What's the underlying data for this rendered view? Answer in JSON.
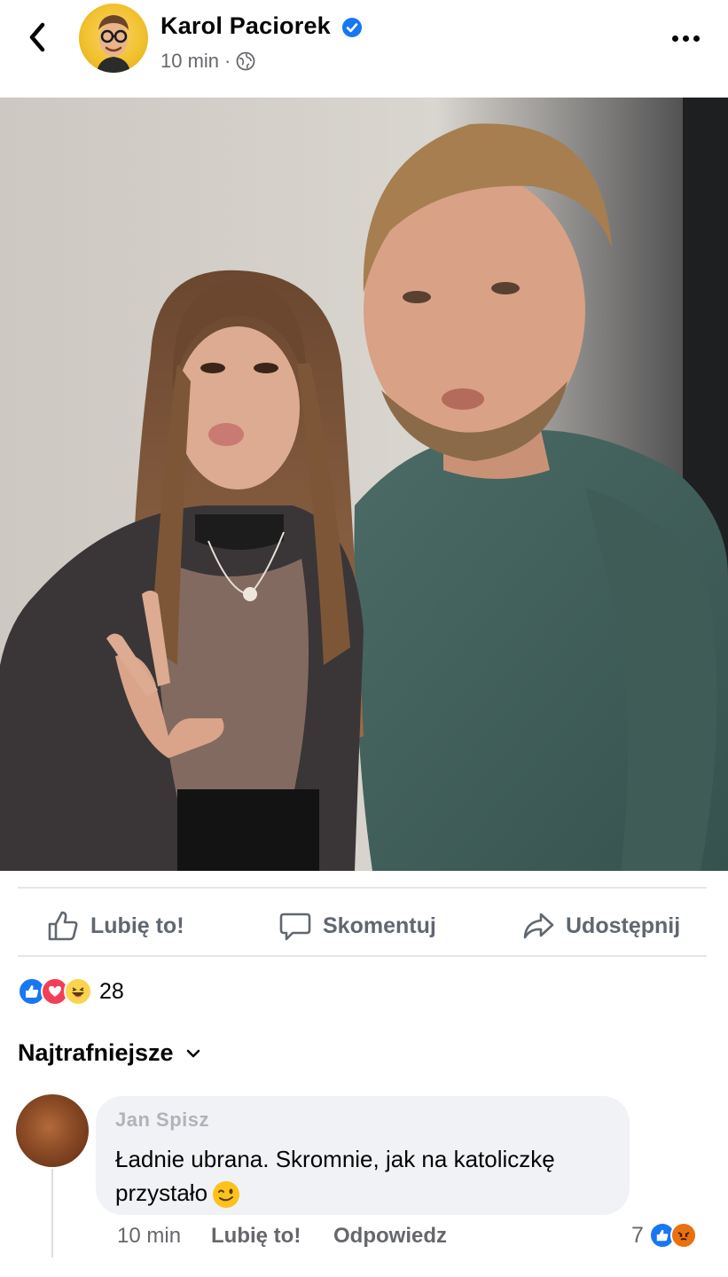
{
  "header": {
    "author": "Karol Paciorek",
    "verified": true,
    "time": "10 min",
    "separator": "·",
    "audience_icon": "globe-icon",
    "back_icon": "chevron-left-icon",
    "more_icon": "more-horizontal-icon"
  },
  "post": {
    "photo_alt": "selfie photo"
  },
  "actions": {
    "like": "Lubię to!",
    "comment": "Skomentuj",
    "share": "Udostępnij"
  },
  "reactions": {
    "types": [
      "like",
      "love",
      "haha"
    ],
    "count": "28"
  },
  "comments": {
    "sort_label": "Najtrafniejsze",
    "items": [
      {
        "author": "Jan Spisz",
        "text": "Ładnie ubrana. Skromnie, jak na katoliczkę przystało",
        "emoji": "winking-face",
        "time": "10 min",
        "like_label": "Lubię to!",
        "reply_label": "Odpowiedz",
        "reaction_count": "7",
        "reaction_types": [
          "like",
          "angry"
        ]
      }
    ]
  },
  "colors": {
    "facebook_blue": "#1877f2",
    "secondary_text": "#65676b",
    "bubble_bg": "#f0f2f5",
    "divider": "#e4e6eb",
    "love_red": "#f33e58",
    "haha_yellow": "#fcd34d",
    "angry_orange": "#e9710f"
  }
}
